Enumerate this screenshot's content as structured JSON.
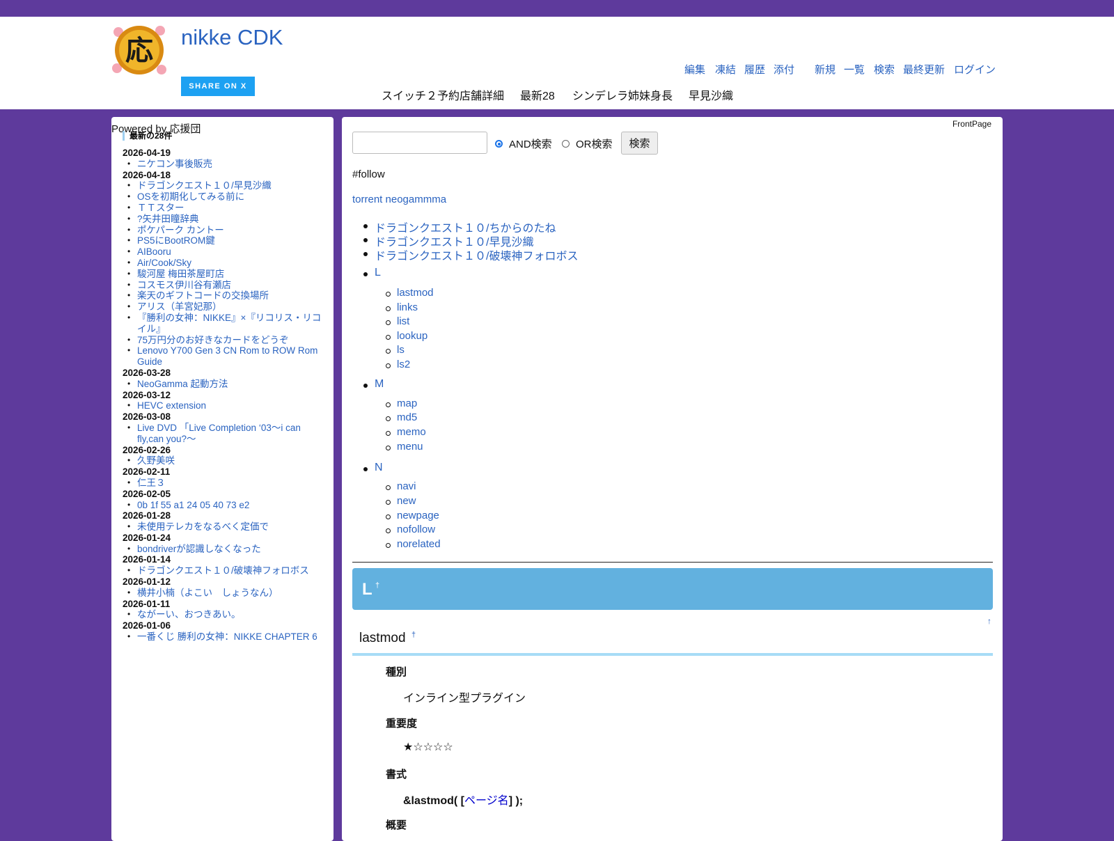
{
  "header": {
    "logo_glyph": "応",
    "site_title": "nikke CDK",
    "share_label": "SHARE ON X",
    "toolbar": [
      "編集",
      "凍結",
      "履歴",
      "添付",
      "新規",
      "一覧",
      "検索",
      "最終更新",
      "ログイン"
    ],
    "hot_nav": [
      "スイッチ２予約店舗詳細",
      "最新28",
      "シンデレラ姉妹身長",
      "早見沙織"
    ]
  },
  "sidebar": {
    "powered": "Powered by 応援団",
    "recent_heading": "最新の28件",
    "recent": [
      {
        "date": "2026-04-19",
        "items": [
          "ニケコン事後販売"
        ]
      },
      {
        "date": "2026-04-18",
        "items": [
          "ドラゴンクエスト１０/早見沙織",
          "OSを初期化してみる前に",
          "ＴＴスター",
          "?矢井田瞳辞典",
          "ポケパーク カントー",
          "PS5にBootROM鍵",
          "AIBooru",
          "Air/Cook/Sky",
          "駿河屋 梅田茶屋町店",
          "コスモス伊川谷有瀬店",
          "楽天のギフトコードの交換場所",
          "アリス（羊宮妃那）",
          "『勝利の女神：NIKKE』×『リコリス・リコイル』",
          "75万円分のお好きなカードをどうぞ",
          "Lenovo Y700 Gen 3 CN Rom to ROW Rom Guide"
        ]
      },
      {
        "date": "2026-03-28",
        "items": [
          "NeoGamma 起動方法"
        ]
      },
      {
        "date": "2026-03-12",
        "items": [
          "HEVC extension"
        ]
      },
      {
        "date": "2026-03-08",
        "items": [
          "Live DVD 「Live Completion ‘03〜i can fly,can you?〜"
        ]
      },
      {
        "date": "2026-02-26",
        "items": [
          "久野美咲"
        ]
      },
      {
        "date": "2026-02-11",
        "items": [
          "仁王３"
        ]
      },
      {
        "date": "2026-02-05",
        "items": [
          "0b 1f 55 a1 24 05 40 73 e2"
        ]
      },
      {
        "date": "2026-01-28",
        "items": [
          "未使用テレカをなるべく定価で"
        ]
      },
      {
        "date": "2026-01-24",
        "items": [
          "bondriverが認識しなくなった"
        ]
      },
      {
        "date": "2026-01-14",
        "items": [
          "ドラゴンクエスト１０/破壊神フォロボス"
        ]
      },
      {
        "date": "2026-01-12",
        "items": [
          "横井小楠（よこい　しょうなん）"
        ]
      },
      {
        "date": "2026-01-11",
        "items": [
          "ながーい、おつきあい。"
        ]
      },
      {
        "date": "2026-01-06",
        "items": [
          "一番くじ 勝利の女神：NIKKE CHAPTER 6"
        ]
      }
    ]
  },
  "content": {
    "page_name": "FrontPage",
    "search": {
      "and_label": "AND検索",
      "or_label": "OR検索",
      "button": "検索",
      "and_selected": true
    },
    "follow_text": "#follow",
    "torrent_link": "torrent neogammma",
    "dq_links": [
      "ドラゴンクエスト１０/ちからのたね",
      "ドラゴンクエスト１０/早見沙織",
      "ドラゴンクエスト１０/破壊神フォロボス"
    ],
    "groups": [
      {
        "letter": "L",
        "items": [
          "lastmod",
          "links",
          "list",
          "lookup",
          "ls",
          "ls2"
        ]
      },
      {
        "letter": "M",
        "items": [
          "map",
          "md5",
          "memo",
          "menu"
        ]
      },
      {
        "letter": "N",
        "items": [
          "navi",
          "new",
          "newpage",
          "nofollow",
          "norelated"
        ]
      }
    ],
    "heading_l": "L",
    "anchor_mark": "†",
    "top_arrow": "↑",
    "heading_lastmod": "lastmod",
    "definitions": {
      "type_label": "種別",
      "type_value": "インライン型プラグイン",
      "importance_label": "重要度",
      "importance_value": "★☆☆☆☆",
      "format_label": "書式",
      "format_prefix": "&lastmod( [",
      "format_link": "ページ名",
      "format_suffix": "] );",
      "summary_label": "概要"
    }
  }
}
